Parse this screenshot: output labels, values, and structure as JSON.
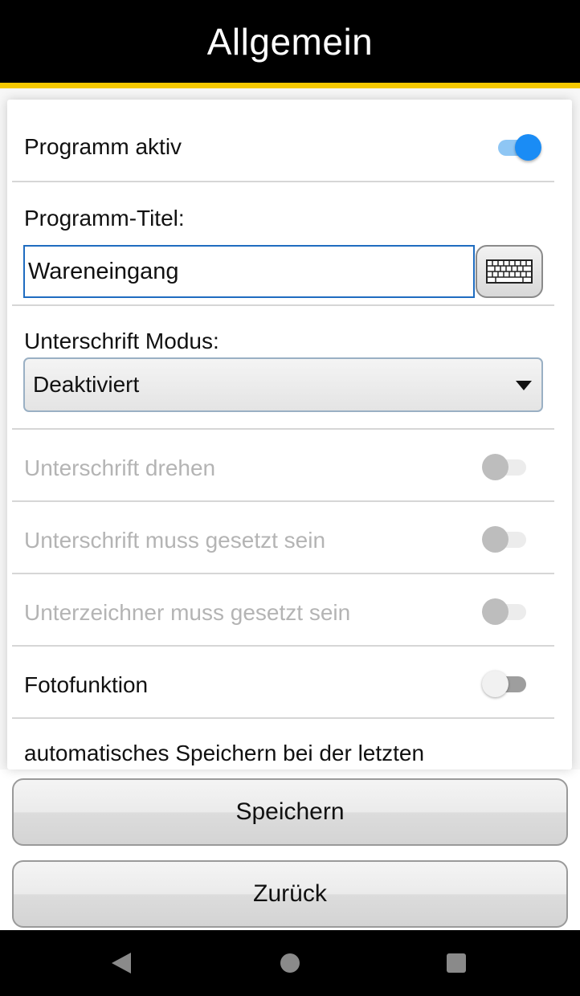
{
  "header": {
    "title": "Allgemein"
  },
  "settings": {
    "programm_aktiv": {
      "label": "Programm aktiv",
      "enabled": true
    },
    "programm_titel": {
      "label": "Programm-Titel:",
      "value": "Wareneingang"
    },
    "unterschrift_modus": {
      "label": "Unterschrift Modus:",
      "selected": "Deaktiviert"
    },
    "unterschrift_drehen": {
      "label": "Unterschrift drehen",
      "enabled": false,
      "disabled": true
    },
    "unterschrift_muss": {
      "label": "Unterschrift muss gesetzt sein",
      "enabled": false,
      "disabled": true
    },
    "unterzeichner_muss": {
      "label": "Unterzeichner muss gesetzt sein",
      "enabled": false,
      "disabled": true
    },
    "fotofunktion": {
      "label": "Fotofunktion",
      "enabled": false
    },
    "auto_speichern": {
      "label": "automatisches Speichern bei der letzten"
    }
  },
  "buttons": {
    "save": "Speichern",
    "back": "Zurück"
  },
  "colors": {
    "accent": "#1a8cf5",
    "stripe": "#f5c800",
    "header": "#000000"
  },
  "icons": {
    "keyboard": "keyboard-icon",
    "nav_back": "nav-back-icon",
    "nav_home": "nav-home-icon",
    "nav_recent": "nav-recent-icon"
  }
}
